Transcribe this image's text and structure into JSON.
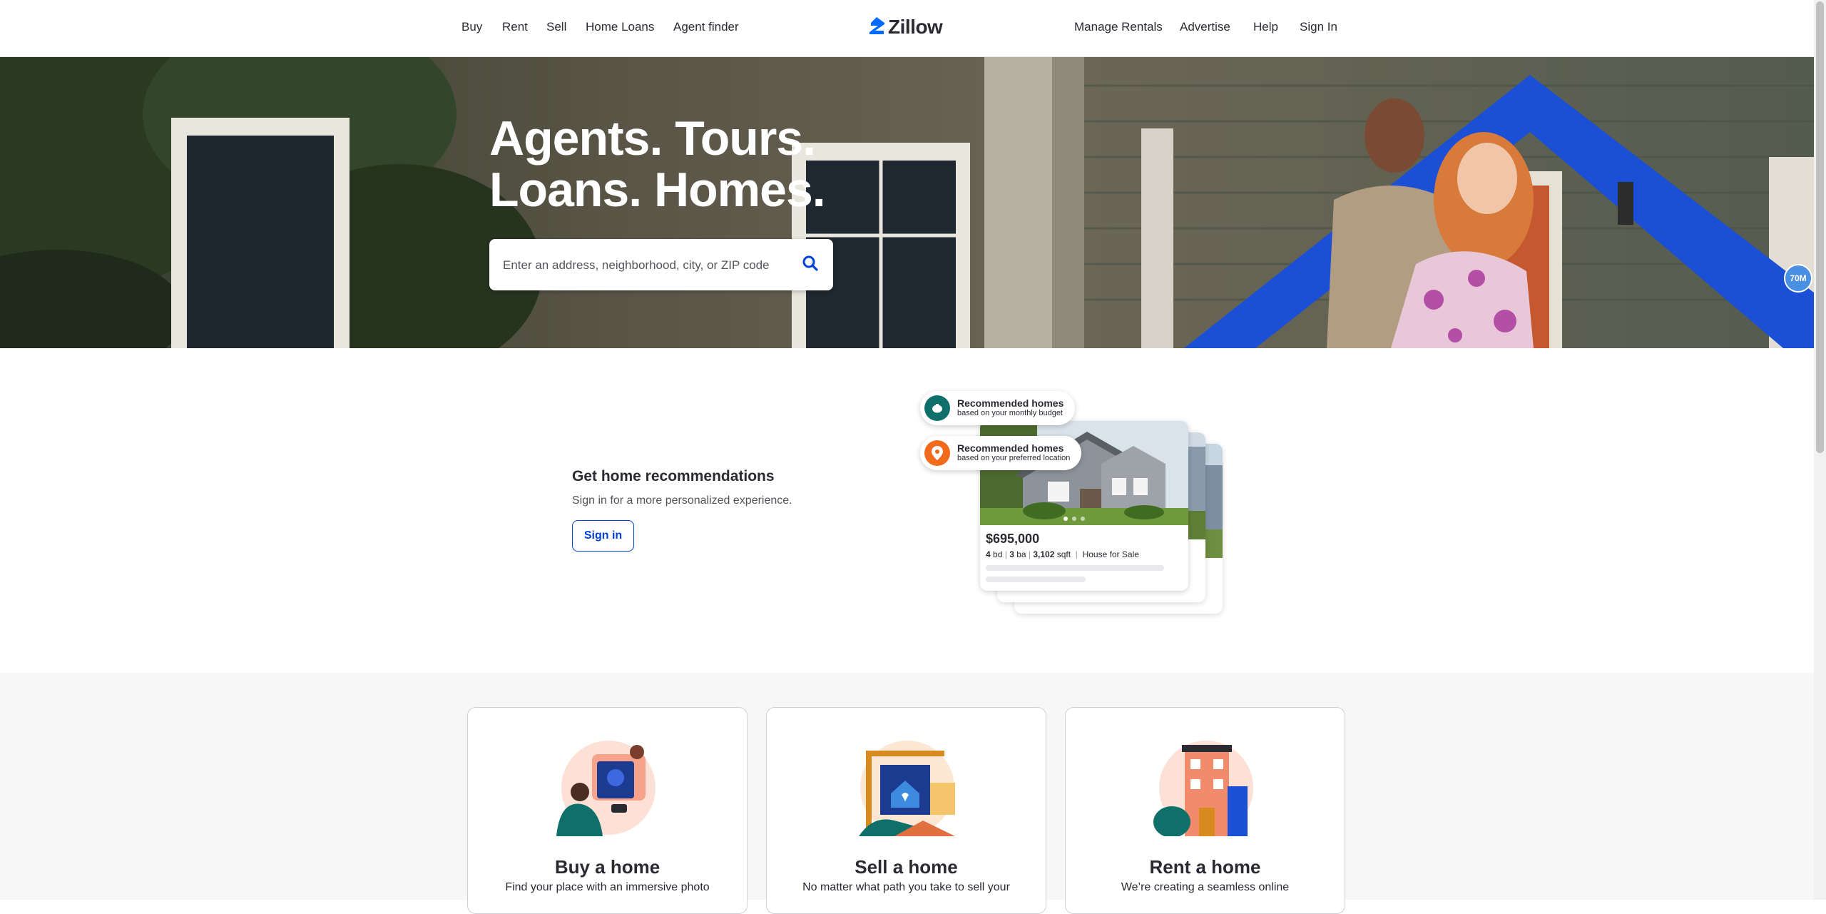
{
  "nav": {
    "left": [
      "Buy",
      "Rent",
      "Sell",
      "Home Loans",
      "Agent finder"
    ],
    "logo_text": "Zillow",
    "right": [
      "Manage Rentals",
      "Advertise",
      "Help",
      "Sign In"
    ]
  },
  "hero": {
    "title_line1": "Agents. Tours.",
    "title_line2": "Loans. Homes.",
    "search_placeholder": "Enter an address, neighborhood, city, or ZIP code",
    "badge": "70M"
  },
  "recommendations": {
    "heading": "Get home recommendations",
    "subtext": "Sign in for a more personalized experience.",
    "button": "Sign in",
    "pill1_title": "Recommended homes",
    "pill1_sub": "based on your monthly budget",
    "pill2_title": "Recommended homes",
    "pill2_sub": "based on your preferred location",
    "price": "$695,000",
    "beds": "4",
    "beds_unit": "bd",
    "baths": "3",
    "baths_unit": "ba",
    "sqft": "3,102",
    "sqft_unit": "sqft",
    "listing_type": "House for Sale"
  },
  "cards": [
    {
      "title": "Buy a home",
      "desc": "Find your place with an immersive photo"
    },
    {
      "title": "Sell a home",
      "desc": "No matter what path you take to sell your"
    },
    {
      "title": "Rent a home",
      "desc": "We’re creating a seamless online"
    }
  ],
  "colors": {
    "brand_blue": "#006aff",
    "link_blue": "#0041d9",
    "teal": "#0f6f6a",
    "orange": "#f26b1d"
  }
}
